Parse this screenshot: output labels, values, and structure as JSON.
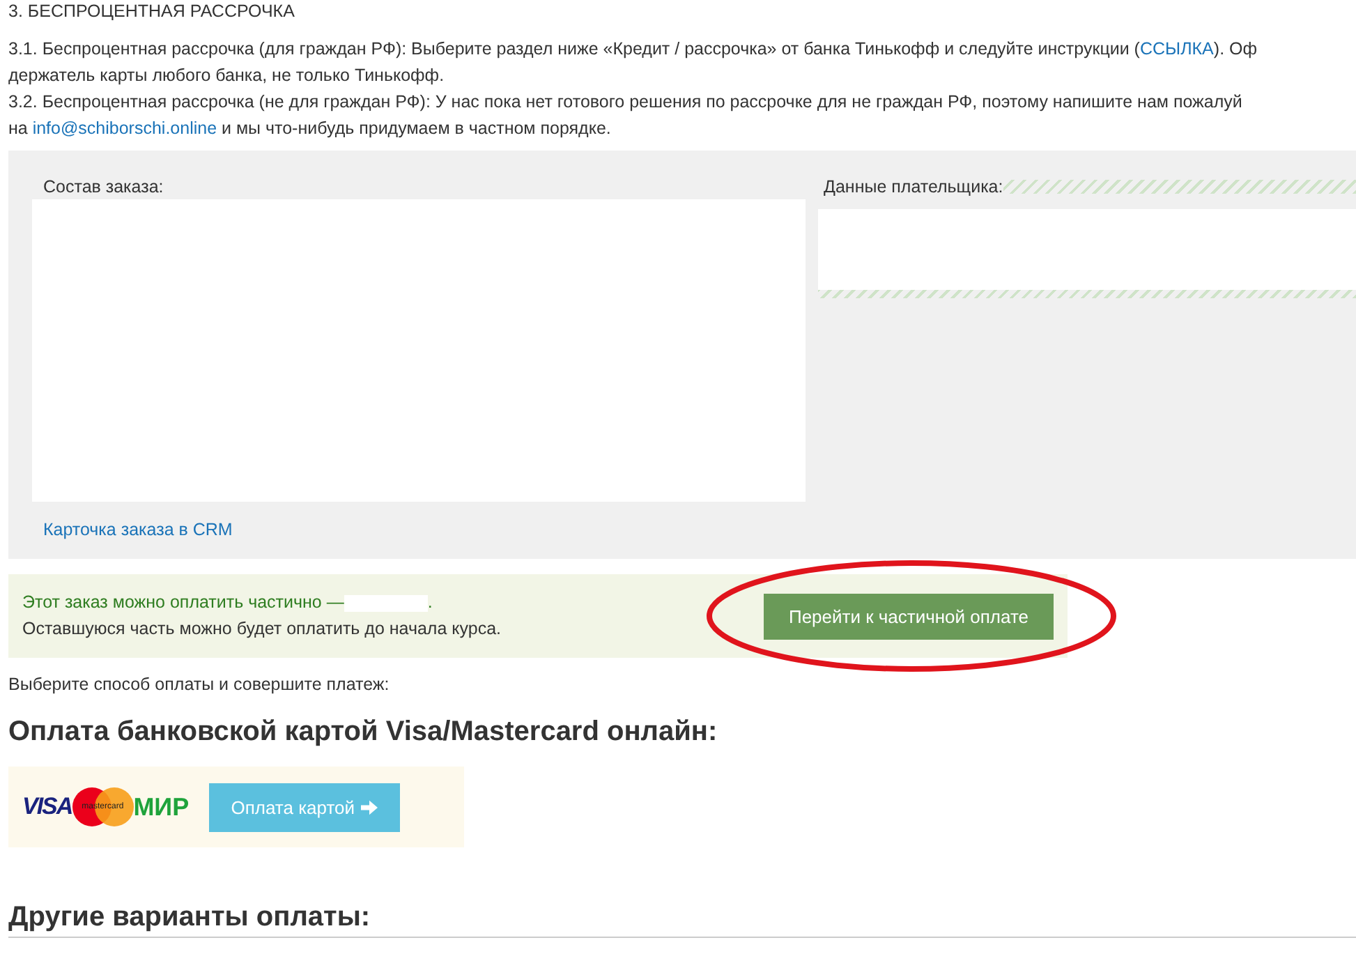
{
  "section_title": "3. БЕСПРОЦЕНТНАЯ РАССРОЧКА",
  "intro_lines": [
    {
      "before": "3.1. Беспроцентная рассрочка (для граждан РФ): Выберите раздел ниже «Кредит / рассрочка» от банка Тинькофф и следуйте инструкции (",
      "link": "ССЫЛКА",
      "after": "). Оф"
    },
    {
      "before": "держатель карты любого банка, не только Тинькофф."
    },
    {
      "before": "3.2. Беспроцентная рассрочка (не для граждан РФ): У нас пока нет готового решения по рассрочке для не граждан РФ, поэтому напишите нам пожалуй"
    },
    {
      "before": "на ",
      "link": "info@schiborschi.online",
      "after": " и мы что-нибудь придумаем в частном порядке."
    }
  ],
  "order_panel": {
    "order_label": "Состав заказа:",
    "payer_label": "Данные плательщика:",
    "crm_link": "Карточка заказа в CRM"
  },
  "notice": {
    "line1": "Этот заказ можно оплатить частично — ",
    "line1_end": ".",
    "line2": "Оставшуюся часть можно будет оплатить до начала курса.",
    "button": "Перейти к частичной оплате",
    "circled": true
  },
  "choose_text": "Выберите способ оплаты и совершите платеж:",
  "card_heading": "Оплата банковской картой Visa/Mastercard онлайн:",
  "card_logos": [
    "VISA",
    "mastercard",
    "МИР"
  ],
  "card_button": "Оплата картой",
  "other_heading": "Другие варианты оплаты:"
}
